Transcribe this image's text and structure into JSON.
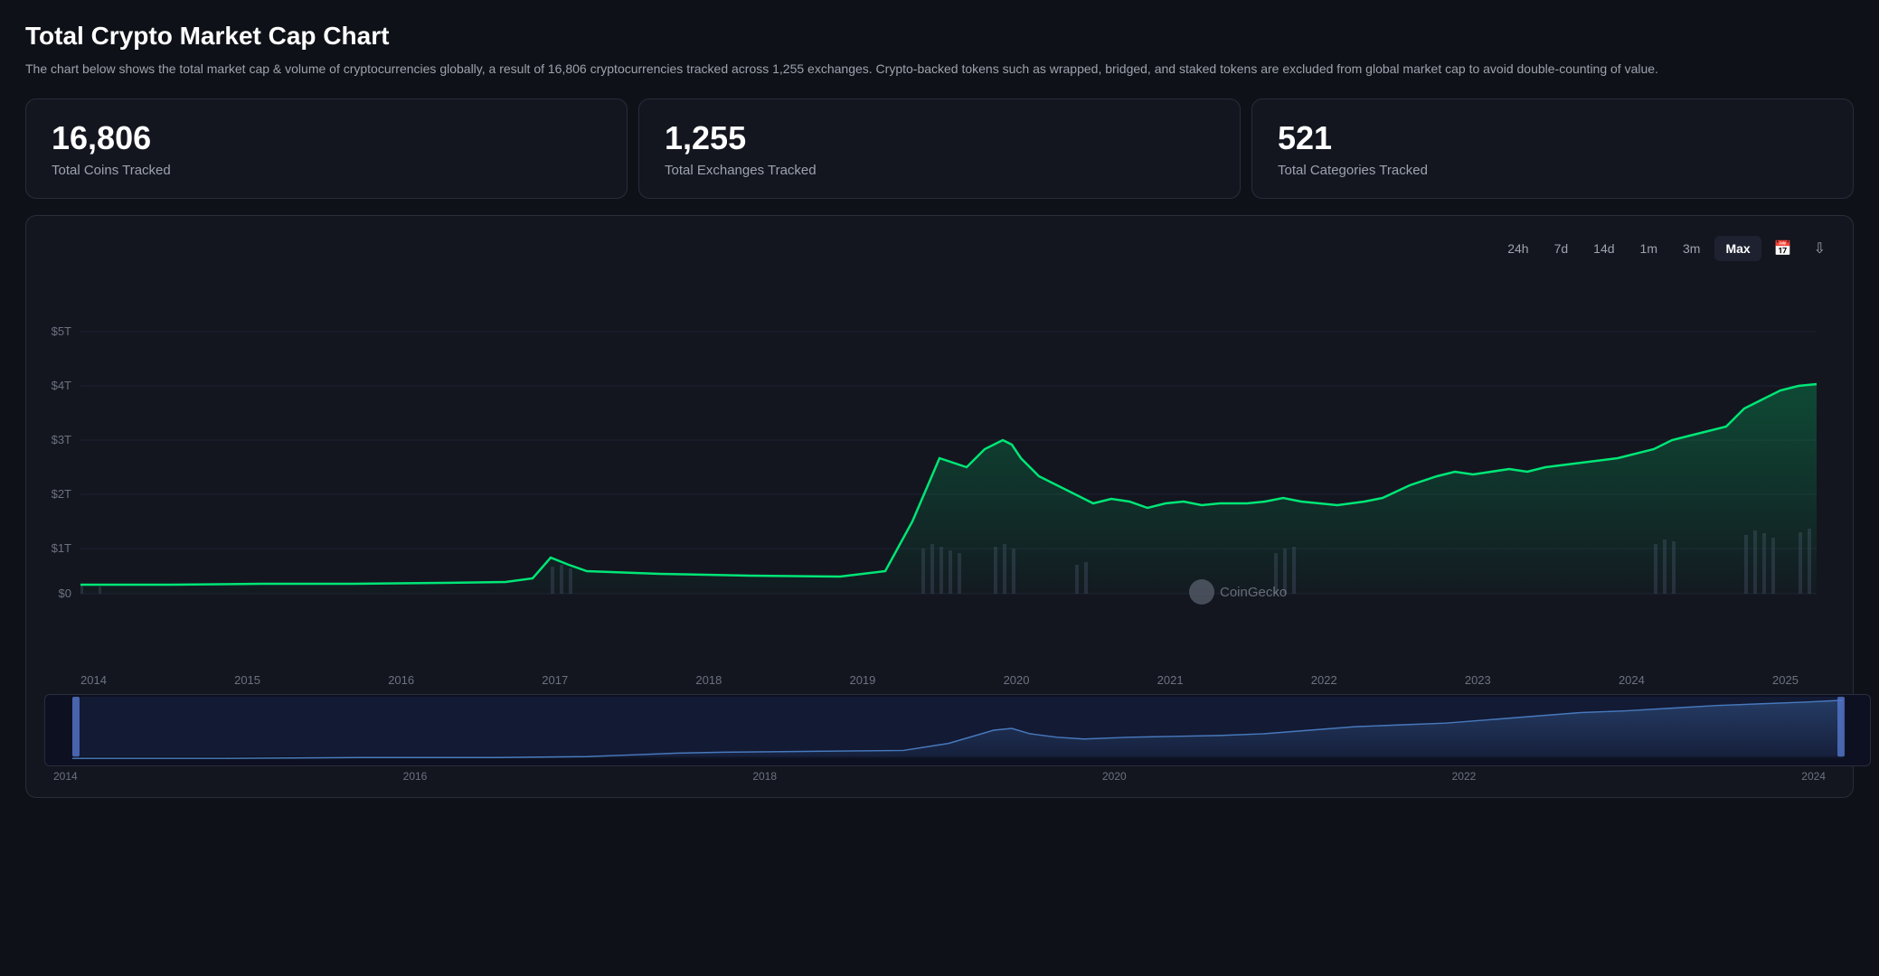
{
  "page": {
    "title": "Total Crypto Market Cap Chart",
    "description": "The chart below shows the total market cap & volume of cryptocurrencies globally, a result of 16,806 cryptocurrencies tracked across 1,255 exchanges. Crypto-backed tokens such as wrapped, bridged, and staked tokens are excluded from global market cap to avoid double-counting of value."
  },
  "stats": [
    {
      "id": "coins",
      "number": "16,806",
      "label": "Total Coins Tracked"
    },
    {
      "id": "exchanges",
      "number": "1,255",
      "label": "Total Exchanges Tracked"
    },
    {
      "id": "categories",
      "number": "521",
      "label": "Total Categories Tracked"
    }
  ],
  "timeButtons": [
    {
      "id": "24h",
      "label": "24h",
      "active": false
    },
    {
      "id": "7d",
      "label": "7d",
      "active": false
    },
    {
      "id": "14d",
      "label": "14d",
      "active": false
    },
    {
      "id": "1m",
      "label": "1m",
      "active": false
    },
    {
      "id": "3m",
      "label": "3m",
      "active": false
    },
    {
      "id": "max",
      "label": "Max",
      "active": true
    }
  ],
  "chart": {
    "yAxisLabels": [
      "$5T",
      "$4T",
      "$3T",
      "$2T",
      "$1T",
      "$0"
    ],
    "xAxisLabels": [
      "2014",
      "2015",
      "2016",
      "2017",
      "2018",
      "2019",
      "2020",
      "2021",
      "2022",
      "2023",
      "2024",
      "2025"
    ],
    "miniXLabels": [
      "2014",
      "2016",
      "2018",
      "2020",
      "2022",
      "2024"
    ],
    "watermark": "CoinGecko"
  },
  "colors": {
    "accent": "#00e676",
    "background": "#13161f",
    "border": "#2a2d3a",
    "gridLine": "#1e2130",
    "text": "#9ca3af",
    "volumeBar": "#3d4257",
    "fillGradientTop": "#00e67620",
    "fillGradientBottom": "#00e67605",
    "miniLine": "#4a7fc1",
    "miniFill": "#1a2540"
  }
}
